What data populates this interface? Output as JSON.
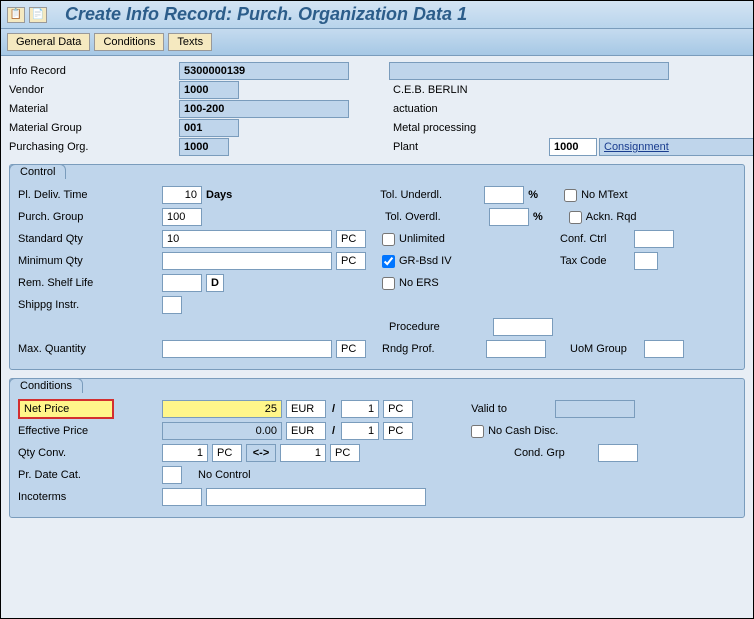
{
  "title": "Create Info Record: Purch. Organization Data 1",
  "tabs": {
    "general": "General Data",
    "conditions": "Conditions",
    "texts": "Texts"
  },
  "header": {
    "info_record_label": "Info Record",
    "info_record": "5300000139",
    "vendor_label": "Vendor",
    "vendor": "1000",
    "vendor_name": "C.E.B. BERLIN",
    "material_label": "Material",
    "material": "100-200",
    "material_desc": "actuation",
    "matgroup_label": "Material Group",
    "matgroup": "001",
    "matgroup_desc": "Metal processing",
    "porg_label": "Purchasing Org.",
    "porg": "1000",
    "plant_label": "Plant",
    "plant": "1000",
    "plant_link": "Consignment"
  },
  "control": {
    "title": "Control",
    "pl_deliv_label": "Pl. Deliv. Time",
    "pl_deliv": "10",
    "days": "Days",
    "pgroup_label": "Purch. Group",
    "pgroup": "100",
    "stdqty_label": "Standard Qty",
    "stdqty": "10",
    "pc": "PC",
    "minqty_label": "Minimum Qty",
    "minqty": "",
    "remshelf_label": "Rem. Shelf Life",
    "remshelf": "",
    "d": "D",
    "shippg_label": "Shippg Instr.",
    "maxqty_label": "Max. Quantity",
    "maxqty": "",
    "tol_under_label": "Tol. Underdl.",
    "pct": "%",
    "tol_over_label": "Tol. Overdl.",
    "unlimited": "Unlimited",
    "grbsd": "GR-Bsd IV",
    "noers": "No ERS",
    "nomtext": "No MText",
    "acknrqd": "Ackn. Rqd",
    "confctrl_label": "Conf. Ctrl",
    "taxcode_label": "Tax Code",
    "procedure_label": "Procedure",
    "rndg_label": "Rndg Prof.",
    "uom_label": "UoM Group"
  },
  "cond": {
    "title": "Conditions",
    "netprice_label": "Net Price",
    "netprice": "25",
    "eur": "EUR",
    "per": "1",
    "pc": "PC",
    "effprice_label": "Effective Price",
    "effprice": "0.00",
    "qtyconv_label": "Qty Conv.",
    "qtyconv1": "1",
    "arrow": "<->",
    "qtyconv2": "1",
    "prdate_label": "Pr. Date Cat.",
    "nocontrol": "No Control",
    "incoterms_label": "Incoterms",
    "validto_label": "Valid to",
    "nocash": "No Cash Disc.",
    "condgrp_label": "Cond. Grp",
    "slash": "/"
  }
}
